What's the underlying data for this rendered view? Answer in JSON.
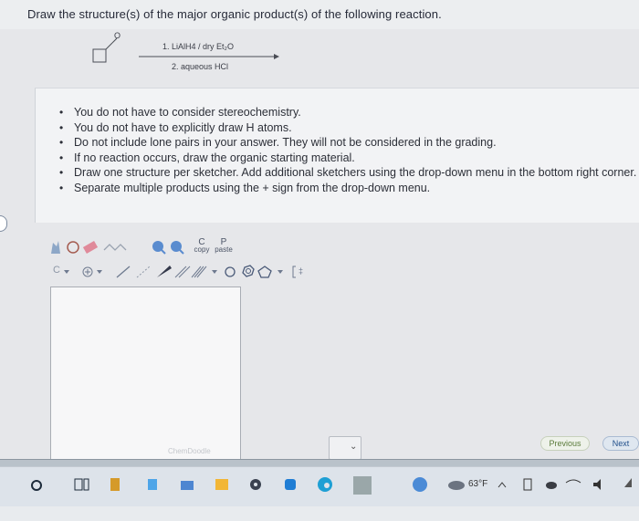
{
  "question": "Draw the structure(s) of the major organic product(s) of the following reaction.",
  "reaction": {
    "reagent_line1": "1. LiAlH4 / dry Et₂O",
    "reagent_line2": "2. aqueous HCl",
    "aldehyde_label": "O"
  },
  "instructions": [
    "You do not have to consider stereochemistry.",
    "You do not have to explicitly draw H atoms.",
    "Do not include lone pairs in your answer. They will not be considered in the grading.",
    "If no reaction occurs, draw the organic starting material.",
    "Draw one structure per sketcher. Add additional sketchers using the drop-down menu in the bottom right corner.",
    "Separate multiple products using the + sign from the drop-down menu."
  ],
  "bullet": "•",
  "toolbar": {
    "copy_letter": "C",
    "copy_label": "copy",
    "paste_letter": "P",
    "paste_label": "paste",
    "carbon_label": "C",
    "help_label": "?"
  },
  "canvas": {
    "watermark": "ChemDoodle"
  },
  "dropdown": {
    "chevron": "⌄"
  },
  "nav": {
    "previous": "Previous",
    "next": "Next"
  },
  "taskbar": {
    "weather": "63°F",
    "accent": "#8aa640"
  }
}
